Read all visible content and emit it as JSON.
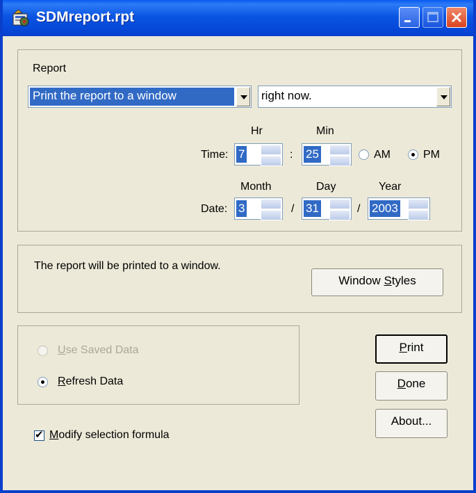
{
  "window": {
    "title": "SDMreport.rpt"
  },
  "report": {
    "group_label": "Report",
    "destination": "Print the report to a window",
    "when": "right now.",
    "time": {
      "label": "Time:",
      "hr_label": "Hr",
      "min_label": "Min",
      "hour": "7",
      "sep": ":",
      "minute": "25",
      "am_label": "AM",
      "pm_label": "PM",
      "selected": "PM"
    },
    "date": {
      "label": "Date:",
      "month_label": "Month",
      "day_label": "Day",
      "year_label": "Year",
      "month": "3",
      "day": "31",
      "year": "2003",
      "sep": "/"
    }
  },
  "info": {
    "message": "The report will be printed to a window.",
    "window_styles_pre": "Window ",
    "window_styles_u": "S",
    "window_styles_post": "tyles"
  },
  "data_source": {
    "use_saved_u": "U",
    "use_saved_rest": "se Saved Data",
    "refresh_u": "R",
    "refresh_rest": "efresh Data",
    "selected": "refresh"
  },
  "options": {
    "modify_u": "M",
    "modify_rest": "odify selection formula",
    "modify_checked": true
  },
  "buttons": {
    "print_u": "P",
    "print_rest": "rint",
    "done_u": "D",
    "done_rest": "one",
    "about": "About..."
  }
}
